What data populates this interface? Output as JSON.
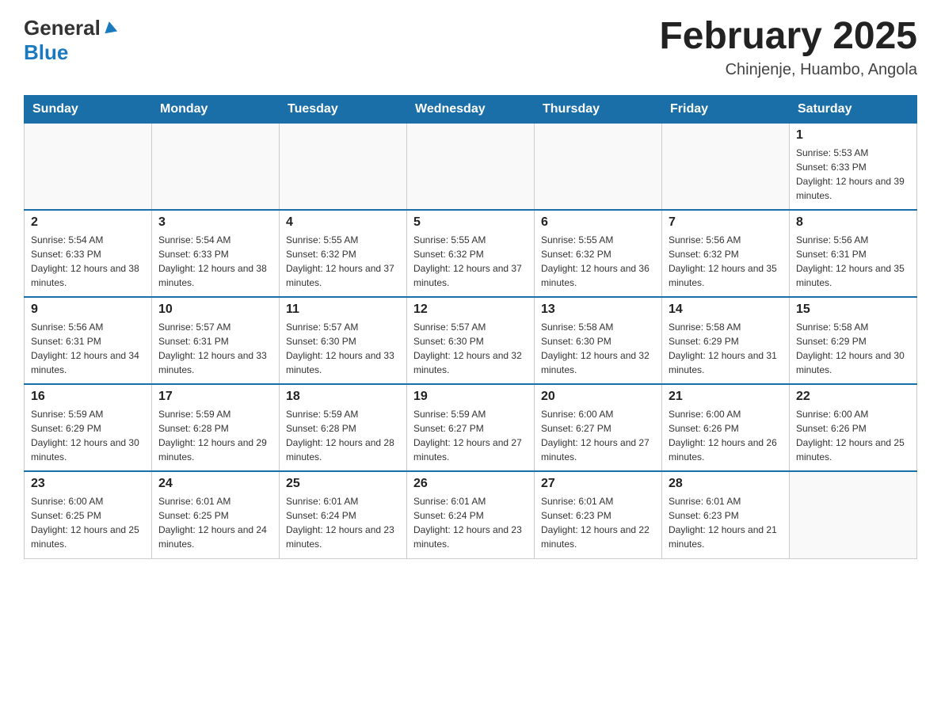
{
  "header": {
    "logo_line1": "General",
    "logo_line2": "Blue",
    "month_title": "February 2025",
    "location": "Chinjenje, Huambo, Angola"
  },
  "days_of_week": [
    "Sunday",
    "Monday",
    "Tuesday",
    "Wednesday",
    "Thursday",
    "Friday",
    "Saturday"
  ],
  "weeks": [
    [
      {
        "day": "",
        "info": ""
      },
      {
        "day": "",
        "info": ""
      },
      {
        "day": "",
        "info": ""
      },
      {
        "day": "",
        "info": ""
      },
      {
        "day": "",
        "info": ""
      },
      {
        "day": "",
        "info": ""
      },
      {
        "day": "1",
        "info": "Sunrise: 5:53 AM\nSunset: 6:33 PM\nDaylight: 12 hours and 39 minutes."
      }
    ],
    [
      {
        "day": "2",
        "info": "Sunrise: 5:54 AM\nSunset: 6:33 PM\nDaylight: 12 hours and 38 minutes."
      },
      {
        "day": "3",
        "info": "Sunrise: 5:54 AM\nSunset: 6:33 PM\nDaylight: 12 hours and 38 minutes."
      },
      {
        "day": "4",
        "info": "Sunrise: 5:55 AM\nSunset: 6:32 PM\nDaylight: 12 hours and 37 minutes."
      },
      {
        "day": "5",
        "info": "Sunrise: 5:55 AM\nSunset: 6:32 PM\nDaylight: 12 hours and 37 minutes."
      },
      {
        "day": "6",
        "info": "Sunrise: 5:55 AM\nSunset: 6:32 PM\nDaylight: 12 hours and 36 minutes."
      },
      {
        "day": "7",
        "info": "Sunrise: 5:56 AM\nSunset: 6:32 PM\nDaylight: 12 hours and 35 minutes."
      },
      {
        "day": "8",
        "info": "Sunrise: 5:56 AM\nSunset: 6:31 PM\nDaylight: 12 hours and 35 minutes."
      }
    ],
    [
      {
        "day": "9",
        "info": "Sunrise: 5:56 AM\nSunset: 6:31 PM\nDaylight: 12 hours and 34 minutes."
      },
      {
        "day": "10",
        "info": "Sunrise: 5:57 AM\nSunset: 6:31 PM\nDaylight: 12 hours and 33 minutes."
      },
      {
        "day": "11",
        "info": "Sunrise: 5:57 AM\nSunset: 6:30 PM\nDaylight: 12 hours and 33 minutes."
      },
      {
        "day": "12",
        "info": "Sunrise: 5:57 AM\nSunset: 6:30 PM\nDaylight: 12 hours and 32 minutes."
      },
      {
        "day": "13",
        "info": "Sunrise: 5:58 AM\nSunset: 6:30 PM\nDaylight: 12 hours and 32 minutes."
      },
      {
        "day": "14",
        "info": "Sunrise: 5:58 AM\nSunset: 6:29 PM\nDaylight: 12 hours and 31 minutes."
      },
      {
        "day": "15",
        "info": "Sunrise: 5:58 AM\nSunset: 6:29 PM\nDaylight: 12 hours and 30 minutes."
      }
    ],
    [
      {
        "day": "16",
        "info": "Sunrise: 5:59 AM\nSunset: 6:29 PM\nDaylight: 12 hours and 30 minutes."
      },
      {
        "day": "17",
        "info": "Sunrise: 5:59 AM\nSunset: 6:28 PM\nDaylight: 12 hours and 29 minutes."
      },
      {
        "day": "18",
        "info": "Sunrise: 5:59 AM\nSunset: 6:28 PM\nDaylight: 12 hours and 28 minutes."
      },
      {
        "day": "19",
        "info": "Sunrise: 5:59 AM\nSunset: 6:27 PM\nDaylight: 12 hours and 27 minutes."
      },
      {
        "day": "20",
        "info": "Sunrise: 6:00 AM\nSunset: 6:27 PM\nDaylight: 12 hours and 27 minutes."
      },
      {
        "day": "21",
        "info": "Sunrise: 6:00 AM\nSunset: 6:26 PM\nDaylight: 12 hours and 26 minutes."
      },
      {
        "day": "22",
        "info": "Sunrise: 6:00 AM\nSunset: 6:26 PM\nDaylight: 12 hours and 25 minutes."
      }
    ],
    [
      {
        "day": "23",
        "info": "Sunrise: 6:00 AM\nSunset: 6:25 PM\nDaylight: 12 hours and 25 minutes."
      },
      {
        "day": "24",
        "info": "Sunrise: 6:01 AM\nSunset: 6:25 PM\nDaylight: 12 hours and 24 minutes."
      },
      {
        "day": "25",
        "info": "Sunrise: 6:01 AM\nSunset: 6:24 PM\nDaylight: 12 hours and 23 minutes."
      },
      {
        "day": "26",
        "info": "Sunrise: 6:01 AM\nSunset: 6:24 PM\nDaylight: 12 hours and 23 minutes."
      },
      {
        "day": "27",
        "info": "Sunrise: 6:01 AM\nSunset: 6:23 PM\nDaylight: 12 hours and 22 minutes."
      },
      {
        "day": "28",
        "info": "Sunrise: 6:01 AM\nSunset: 6:23 PM\nDaylight: 12 hours and 21 minutes."
      },
      {
        "day": "",
        "info": ""
      }
    ]
  ]
}
